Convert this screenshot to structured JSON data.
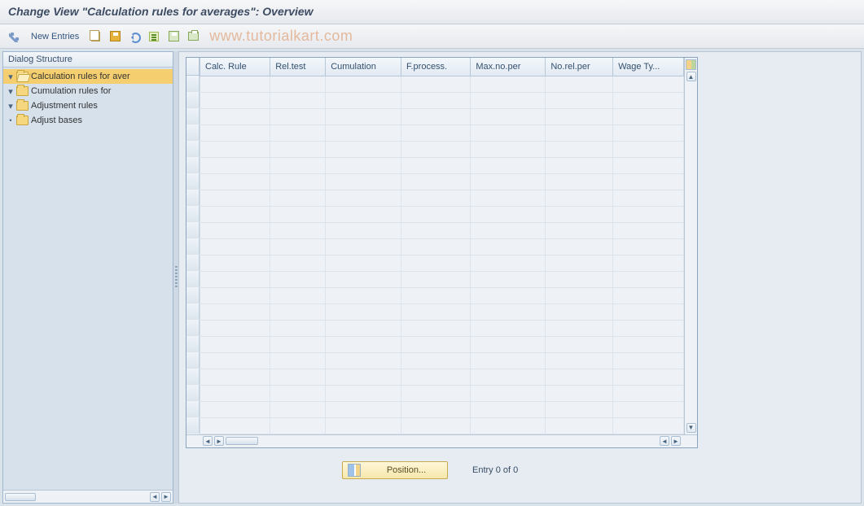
{
  "title": "Change View \"Calculation rules for averages\": Overview",
  "watermark": "www.tutorialkart.com",
  "toolbar": {
    "new_entries": "New Entries"
  },
  "tree": {
    "header": "Dialog Structure",
    "items": [
      {
        "label": "Calculation rules for aver"
      },
      {
        "label": "Cumulation rules for"
      },
      {
        "label": "Adjustment rules"
      },
      {
        "label": "Adjust bases"
      }
    ]
  },
  "grid": {
    "columns": [
      "Calc. Rule",
      "Rel.test",
      "Cumulation",
      "F.process.",
      "Max.no.per",
      "No.rel.per",
      "Wage Ty..."
    ],
    "empty_rows": 22
  },
  "footer": {
    "position_label": "Position...",
    "entry_text": "Entry 0 of 0"
  }
}
